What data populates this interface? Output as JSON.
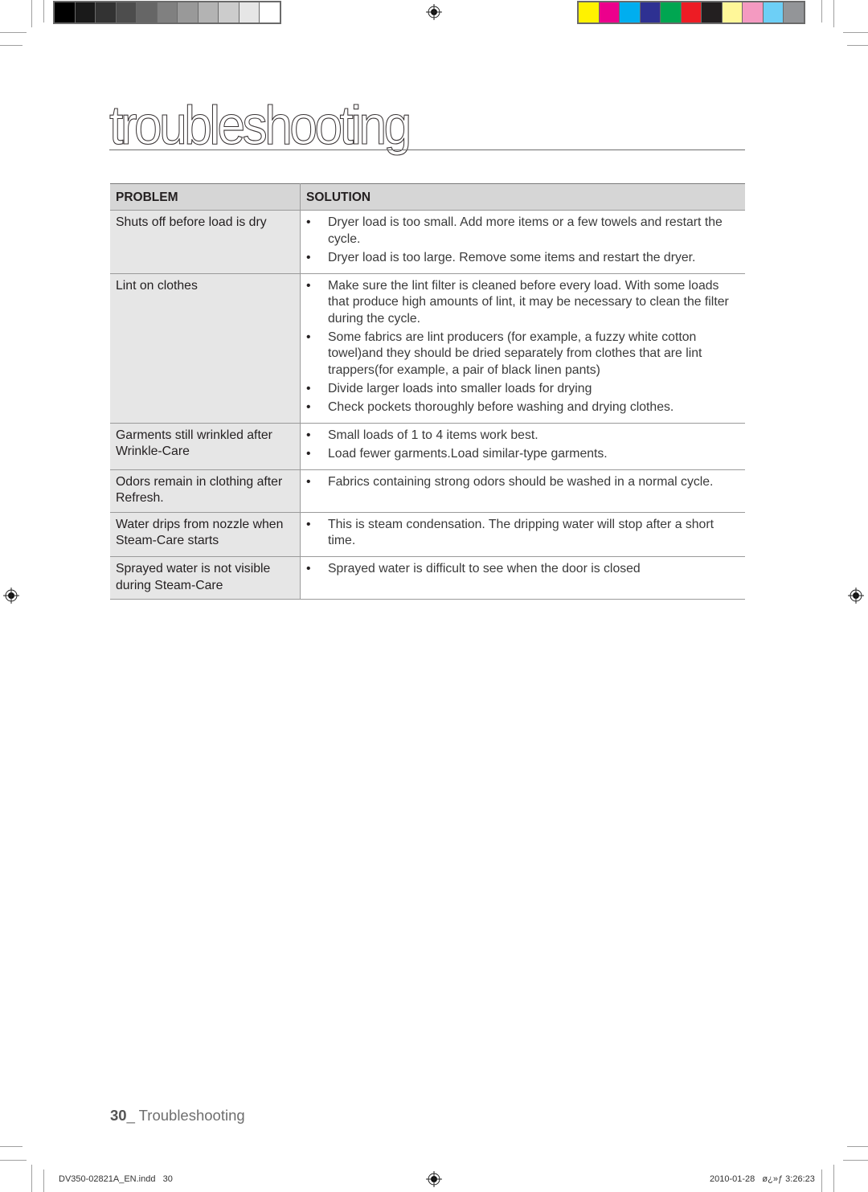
{
  "color_bars": {
    "grayscale": [
      "#000000",
      "#1a1a1a",
      "#333333",
      "#4d4d4d",
      "#666666",
      "#808080",
      "#999999",
      "#b3b3b3",
      "#cccccc",
      "#e6e6e6",
      "#ffffff"
    ],
    "process": [
      "#fff200",
      "#ec008c",
      "#00aeef",
      "#2e3192",
      "#00a651",
      "#ed1c24",
      "#231f20",
      "#fff799",
      "#f49ac1",
      "#6dcff6",
      "#939598"
    ]
  },
  "page": {
    "title": "troubleshooting"
  },
  "table": {
    "headers": {
      "problem": "PROBLEM",
      "solution": "SOLUTION"
    },
    "rows": [
      {
        "problem": "Shuts off before load is dry",
        "solutions": [
          "Dryer load is too small. Add more items or a few towels and restart the cycle.",
          "Dryer load is too large. Remove some items and restart the dryer."
        ]
      },
      {
        "problem": "Lint on clothes",
        "solutions": [
          "Make sure the lint filter is cleaned before every load. With some loads that produce high amounts of lint, it may be necessary to clean the filter during the cycle.",
          "Some fabrics are lint producers (for example, a fuzzy white cotton towel)and they should be dried separately from clothes that are lint trappers(for example, a pair of black linen pants)",
          "Divide larger loads into smaller loads for drying",
          "Check pockets thoroughly before washing and drying clothes."
        ]
      },
      {
        "problem": "Garments still wrinkled after Wrinkle-Care",
        "solutions": [
          "Small loads of 1 to 4 items work best.",
          "Load fewer garments.Load similar-type garments."
        ]
      },
      {
        "problem": "Odors remain in clothing after Refresh.",
        "solutions": [
          "Fabrics containing strong odors should be washed in a normal cycle."
        ]
      },
      {
        "problem": "Water drips from nozzle when Steam-Care starts",
        "solutions": [
          "This is steam condensation. The dripping water will stop after a short time."
        ]
      },
      {
        "problem": "Sprayed water is not visible during Steam-Care",
        "solutions": [
          "Sprayed water is difficult to see when the door is closed"
        ]
      }
    ]
  },
  "footer": {
    "page_number": "30",
    "section": "_ Troubleshooting",
    "slug_file": "DV350-02821A_EN.indd   30",
    "slug_timestamp": "2010-01-28   ø¿»ƒ 3:26:23"
  }
}
